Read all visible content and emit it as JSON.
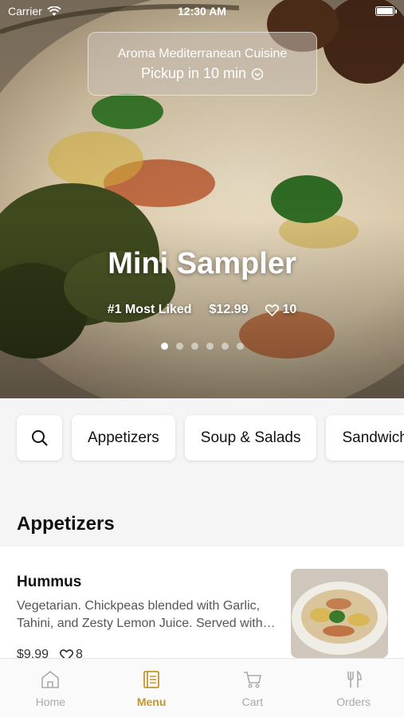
{
  "status_bar": {
    "carrier": "Carrier",
    "time": "12:30 AM"
  },
  "restaurant": {
    "name": "Aroma Mediterranean Cuisine",
    "pickup": "Pickup in 10 min"
  },
  "featured": {
    "title": "Mini Sampler",
    "badge": "#1 Most Liked",
    "price": "$12.99",
    "likes": "10",
    "slide_count": 6,
    "active_slide": 1
  },
  "categories": [
    {
      "label": "Appetizers"
    },
    {
      "label": "Soup & Salads"
    },
    {
      "label": "Sandwiches"
    }
  ],
  "section": {
    "title": "Appetizers"
  },
  "menu_items": [
    {
      "name": "Hummus",
      "description": "Vegetarian. Chickpeas blended with Garlic, Tahini, and Zesty Lemon Juice. Served with pita bread.",
      "price": "$9.99",
      "likes": "8"
    }
  ],
  "tabs": [
    {
      "label": "Home",
      "icon": "home-icon",
      "active": false
    },
    {
      "label": "Menu",
      "icon": "menu-book-icon",
      "active": true
    },
    {
      "label": "Cart",
      "icon": "cart-icon",
      "active": false
    },
    {
      "label": "Orders",
      "icon": "fork-knife-icon",
      "active": false
    }
  ],
  "colors": {
    "accent": "#c7962a",
    "inactive": "#aaaaaa"
  }
}
